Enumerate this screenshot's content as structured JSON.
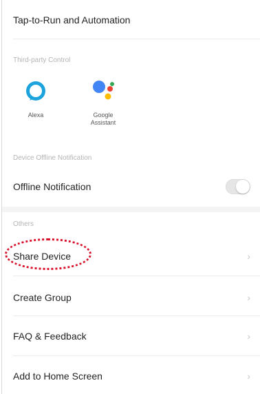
{
  "menu": {
    "tap_to_run": "Tap-to-Run and Automation",
    "third_party_title": "Third-party Control",
    "third_party": [
      {
        "label": "Alexa",
        "icon": "alexa-icon"
      },
      {
        "label": "Google\nAssistant",
        "icon": "google-assistant-icon"
      }
    ],
    "offline_title": "Device Offline Notification",
    "offline_label": "Offline Notification",
    "offline_enabled": false,
    "others_title": "Others",
    "share_device": "Share Device",
    "create_group": "Create Group",
    "faq": "FAQ & Feedback",
    "add_home": "Add to Home Screen",
    "chevron": "›"
  },
  "colors": {
    "highlight": "#d9102a",
    "alexa_blue": "#1aa3dd",
    "google_blue": "#4285f4",
    "google_red": "#ea4335",
    "google_yellow": "#fbbc05",
    "google_green": "#34a853"
  }
}
